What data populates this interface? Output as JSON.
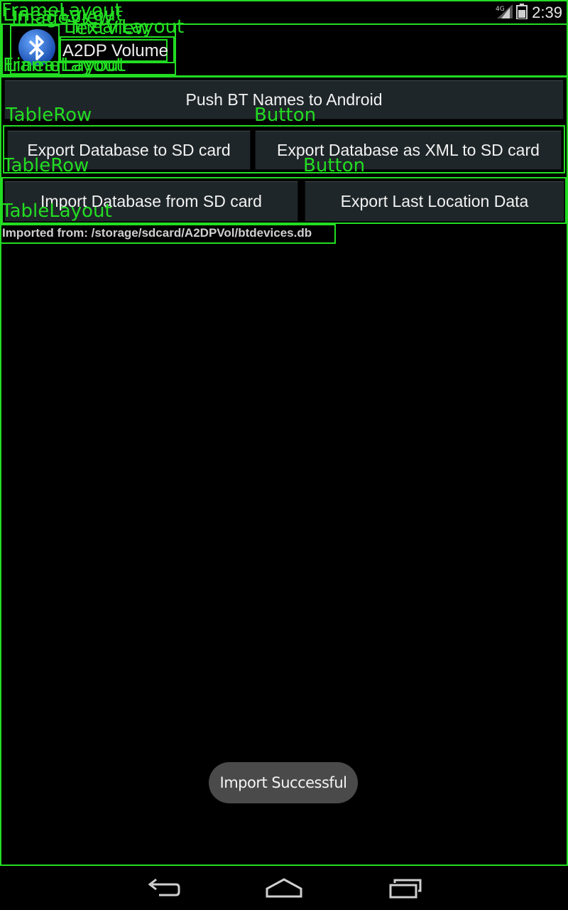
{
  "status_bar": {
    "time": "2:39",
    "network_label": "4G",
    "icons": [
      "signal-icon",
      "battery-icon"
    ]
  },
  "app": {
    "title": "A2DP Volume",
    "icon": "bluetooth-icon"
  },
  "buttons": {
    "push_bt_names": "Push BT Names to Android",
    "export_db_sd": "Export Database to SD card",
    "export_db_xml": "Export Database as XML to SD card",
    "import_db_sd": "Import Database from SD card",
    "export_last_location": "Export Last Location Data"
  },
  "import_path": "Imported from: /storage/sdcard/A2DPVol/btdevices.db",
  "toast": "Import Successful",
  "overlay_labels": {
    "frame": "FrameLayout",
    "linear": "LinearLayout",
    "image": "ImageView",
    "text": "TextView",
    "table_row": "TableRow",
    "button": "Button",
    "table_layout": "TableLayout"
  },
  "nav_bar": {
    "icons": [
      "back-icon",
      "home-icon",
      "recents-icon"
    ]
  },
  "colors": {
    "overlay": "#22dd22",
    "background": "#000000",
    "button": "#1f2629",
    "toast": "#4a4a4a"
  }
}
